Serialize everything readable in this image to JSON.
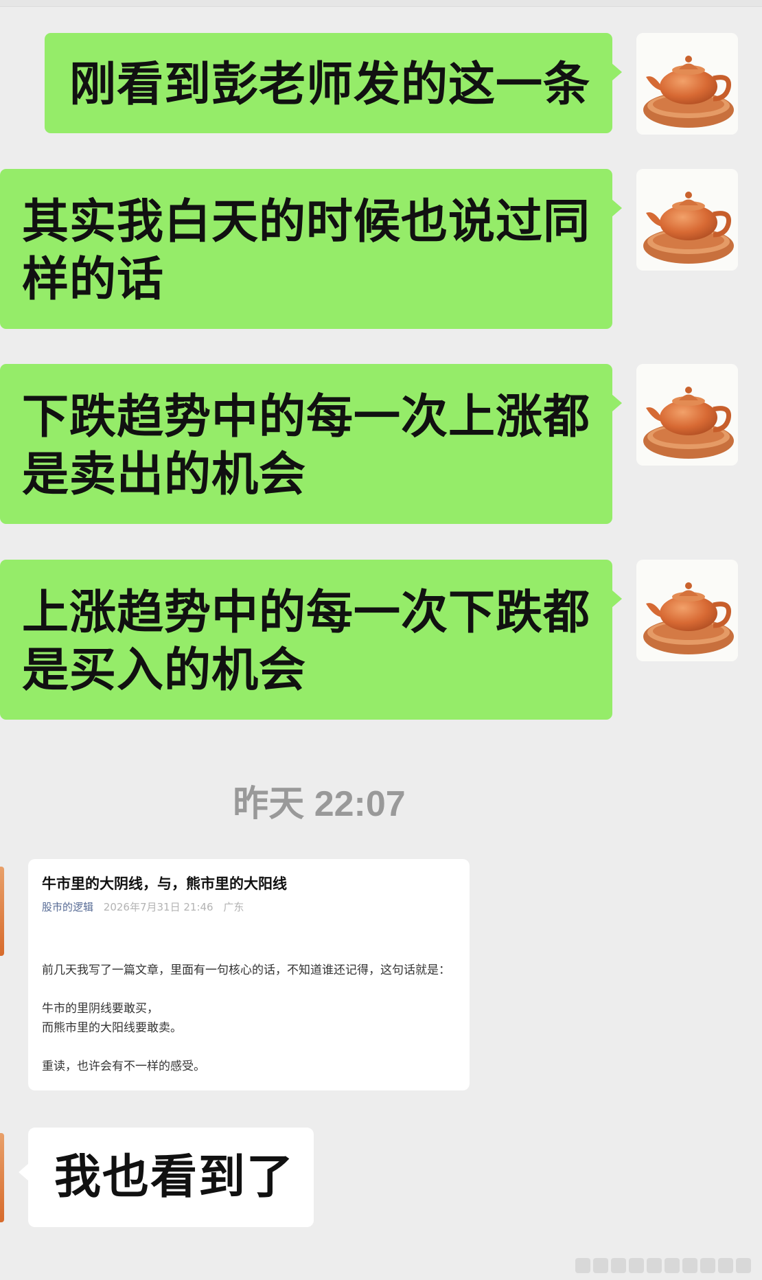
{
  "messages_out": [
    {
      "lines": [
        "刚看到彭老师发的这一条"
      ]
    },
    {
      "lines": [
        "其实我白天的时候也说过同",
        "样的话"
      ]
    },
    {
      "lines": [
        "下跌趋势中的每一次上涨都",
        "是卖出的机会"
      ]
    },
    {
      "lines": [
        "上涨趋势中的每一次下跌都",
        "是买入的机会"
      ]
    }
  ],
  "avatar_icon": "teapot-icon",
  "timestamp": "昨天 22:07",
  "article": {
    "title": "牛市里的大阴线，与，熊市里的大阳线",
    "author": "股市的逻辑",
    "date": "2026年7月31日 21:46",
    "region": "广东",
    "p1": "前几天我写了一篇文章，里面有一句核心的话，不知道谁还记得，这句话就是：",
    "p2": "牛市的里阴线要敢买，",
    "p3": "而熊市里的大阳线要敢卖。",
    "p4": "重读，也许会有不一样的感受。"
  },
  "message_in": "我也看到了",
  "colors": {
    "outgoing": "#95ec69",
    "incoming": "#ffffff",
    "background": "#ededed"
  }
}
